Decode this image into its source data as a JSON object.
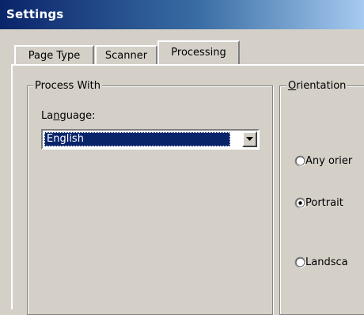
{
  "window": {
    "title": "Settings"
  },
  "tabs": [
    {
      "label": "Page Type",
      "active": false
    },
    {
      "label": "Scanner",
      "active": false
    },
    {
      "label": "Processing",
      "active": true
    }
  ],
  "process_with": {
    "legend": "Process With",
    "language_label_pre": "La",
    "language_label_mnemonic": "n",
    "language_label_post": "guage:",
    "language_value": "English"
  },
  "orientation": {
    "legend_mnemonic": "O",
    "legend_rest": "rientation",
    "options": [
      {
        "label": "Any orier",
        "selected": false
      },
      {
        "label": "Portrait",
        "selected": true
      },
      {
        "label": "Landsca",
        "selected": false
      }
    ]
  },
  "colors": {
    "titlebar_start": "#0a246a",
    "titlebar_end": "#a6caf0",
    "face": "#d4d0c8",
    "selection": "#0a246a"
  }
}
